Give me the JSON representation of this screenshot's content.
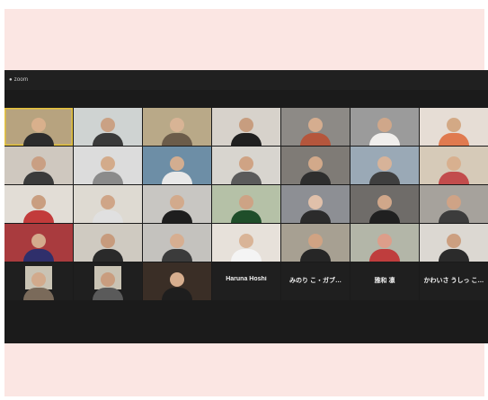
{
  "window": {
    "title": "● zoom"
  },
  "tiles": [
    {
      "bg": "#b7a37f",
      "skin": "#d9b08c",
      "shirt": "#2c2c2c",
      "name": "",
      "active": true
    },
    {
      "bg": "#cfd3d2",
      "skin": "#caa184",
      "shirt": "#3a3a3a",
      "name": ""
    },
    {
      "bg": "#b9a988",
      "skin": "#d8b495",
      "shirt": "#6b5c4a",
      "name": ""
    },
    {
      "bg": "#d7d2cb",
      "skin": "#c79d7f",
      "shirt": "#202020",
      "name": ""
    },
    {
      "bg": "#8d8a86",
      "skin": "#d5ad8f",
      "shirt": "#b5563c",
      "name": ""
    },
    {
      "bg": "#9b9b9b",
      "skin": "#cfa78a",
      "shirt": "#f0eeec",
      "name": ""
    },
    {
      "bg": "#e6ddd5",
      "skin": "#d3a985",
      "shirt": "#e07a4f",
      "name": ""
    },
    {
      "bg": "#cfc8bf",
      "skin": "#c99f83",
      "shirt": "#3b3b3b",
      "name": ""
    },
    {
      "bg": "#dcdcdc",
      "skin": "#d3ab8b",
      "shirt": "#8b8b8b",
      "name": ""
    },
    {
      "bg": "#6d8ea6",
      "skin": "#d2ad90",
      "shirt": "#e8e8e8",
      "name": ""
    },
    {
      "bg": "#d8d5cf",
      "skin": "#cfa384",
      "shirt": "#5b5b5b",
      "name": ""
    },
    {
      "bg": "#7f7b76",
      "skin": "#d2a98a",
      "shirt": "#2e2e2e",
      "name": ""
    },
    {
      "bg": "#9aa9b6",
      "skin": "#d7b399",
      "shirt": "#3f3f3f",
      "name": ""
    },
    {
      "bg": "#d6cab8",
      "skin": "#d8b08f",
      "shirt": "#c24c4c",
      "name": ""
    },
    {
      "bg": "#e2ddd6",
      "skin": "#c99e80",
      "shirt": "#c23b3b",
      "name": ""
    },
    {
      "bg": "#dedad2",
      "skin": "#cfa587",
      "shirt": "#e0e0e0",
      "name": ""
    },
    {
      "bg": "#c8c6c2",
      "skin": "#d2aa8c",
      "shirt": "#1e1e1e",
      "name": ""
    },
    {
      "bg": "#b5c1a7",
      "skin": "#cda385",
      "shirt": "#1f4e2a",
      "name": ""
    },
    {
      "bg": "#8d8f94",
      "skin": "#e0c0aa",
      "shirt": "#2b2b2b",
      "name": ""
    },
    {
      "bg": "#6f6c69",
      "skin": "#d0a78a",
      "shirt": "#202020",
      "name": ""
    },
    {
      "bg": "#a6a29c",
      "skin": "#cfa386",
      "shirt": "#3c3c3c",
      "name": ""
    },
    {
      "bg": "#a93b3e",
      "skin": "#d4ab8d",
      "shirt": "#2f2f6b",
      "name": ""
    },
    {
      "bg": "#cfcac1",
      "skin": "#c79b7d",
      "shirt": "#2a2a2a",
      "name": ""
    },
    {
      "bg": "#c4c2be",
      "skin": "#d6ae91",
      "shirt": "#3b3b3b",
      "name": ""
    },
    {
      "bg": "#e7e1da",
      "skin": "#d9b497",
      "shirt": "#f4f4f4",
      "name": ""
    },
    {
      "bg": "#a7a092",
      "skin": "#d0a383",
      "shirt": "#262626",
      "name": ""
    },
    {
      "bg": "#b3b6a8",
      "skin": "#dd9e8a",
      "shirt": "#bf3d3d",
      "name": ""
    },
    {
      "bg": "#dcd8d2",
      "skin": "#cc9f80",
      "shirt": "#2b2b2b",
      "name": ""
    },
    {
      "bg": "#1f1f1f",
      "skin": "#d2aa8c",
      "shirt": "#7a6a5a",
      "name": "",
      "thumb": true
    },
    {
      "bg": "#1f1f1f",
      "skin": "#c99d7f",
      "shirt": "#5a5a5a",
      "name": "",
      "thumb": true
    },
    {
      "bg": "#3a2e26",
      "skin": "#d7ae8e",
      "shirt": "#1e1e1e",
      "name": ""
    },
    {
      "bg": "#1f1f1f",
      "name": "",
      "bigname": "Haruna Hoshi",
      "dark": true
    },
    {
      "bg": "#1f1f1f",
      "name": "",
      "bigname": "みのり こ・ガブ…",
      "dark": true
    },
    {
      "bg": "#1f1f1f",
      "name": "",
      "bigname": "雅和 凛",
      "dark": true
    },
    {
      "bg": "#1f1f1f",
      "name": "",
      "bigname": "かわいさ うしっ こ…",
      "dark": true
    }
  ]
}
